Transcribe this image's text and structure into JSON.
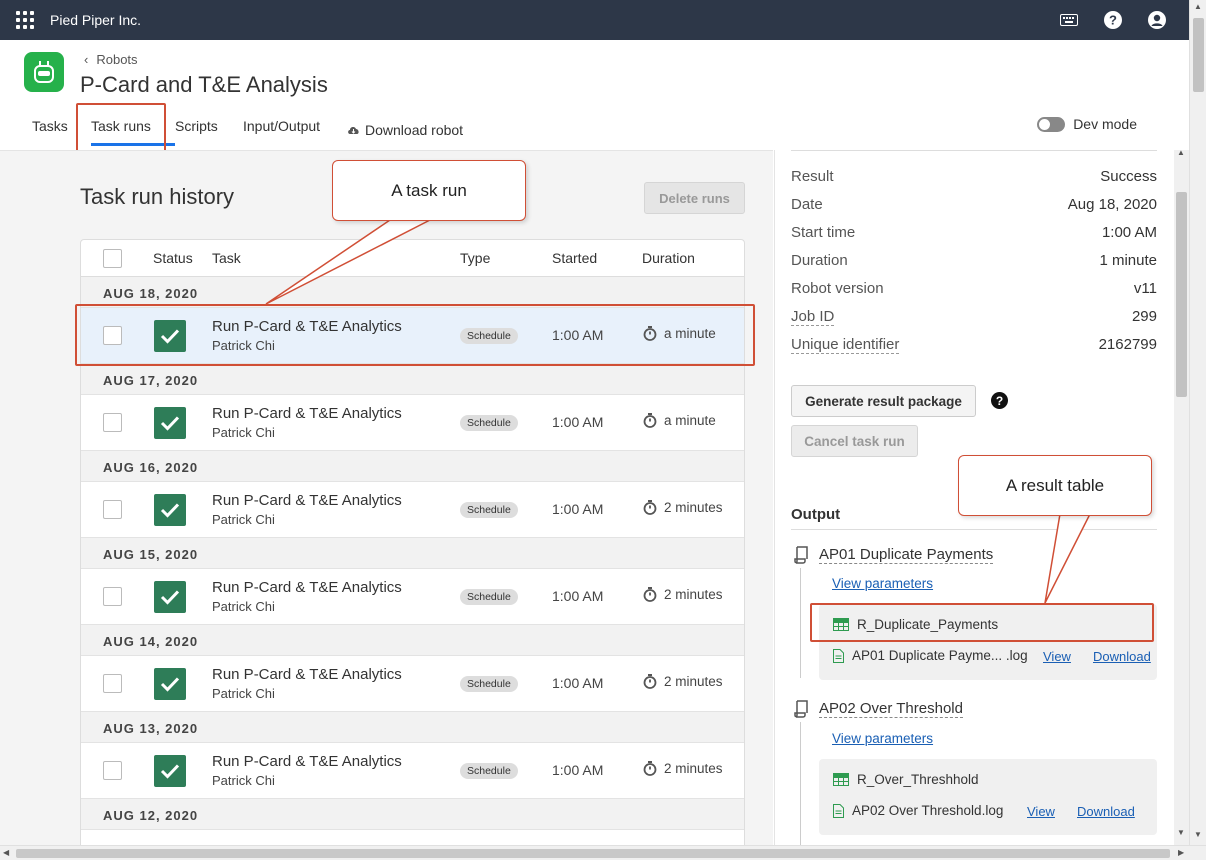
{
  "app": {
    "org_name": "Pied Piper Inc.",
    "breadcrumb": "Robots",
    "title": "P-Card and T&E Analysis",
    "tabs": [
      "Tasks",
      "Task runs",
      "Scripts",
      "Input/Output",
      "Download robot"
    ],
    "active_tab": "Task runs",
    "dev_mode_label": "Dev mode",
    "dev_mode_on": false
  },
  "history": {
    "title": "Task run history",
    "delete_label": "Delete runs",
    "columns": {
      "status": "Status",
      "task": "Task",
      "type": "Type",
      "started": "Started",
      "duration": "Duration"
    },
    "groups": [
      {
        "date": "AUG 18, 2020",
        "task": "Run P-Card & T&E Analytics",
        "user": "Patrick Chi",
        "type": "Schedule",
        "started": "1:00 AM",
        "duration": "a minute"
      },
      {
        "date": "AUG 17, 2020",
        "task": "Run P-Card & T&E Analytics",
        "user": "Patrick Chi",
        "type": "Schedule",
        "started": "1:00 AM",
        "duration": "a minute"
      },
      {
        "date": "AUG 16, 2020",
        "task": "Run P-Card & T&E Analytics",
        "user": "Patrick Chi",
        "type": "Schedule",
        "started": "1:00 AM",
        "duration": "2 minutes"
      },
      {
        "date": "AUG 15, 2020",
        "task": "Run P-Card & T&E Analytics",
        "user": "Patrick Chi",
        "type": "Schedule",
        "started": "1:00 AM",
        "duration": "2 minutes"
      },
      {
        "date": "AUG 14, 2020",
        "task": "Run P-Card & T&E Analytics",
        "user": "Patrick Chi",
        "type": "Schedule",
        "started": "1:00 AM",
        "duration": "2 minutes"
      },
      {
        "date": "AUG 13, 2020",
        "task": "Run P-Card & T&E Analytics",
        "user": "Patrick Chi",
        "type": "Schedule",
        "started": "1:00 AM",
        "duration": "2 minutes"
      }
    ],
    "last_date": "AUG 12, 2020"
  },
  "details": {
    "rows": [
      {
        "key": "Result",
        "value": "Success",
        "dotted": false
      },
      {
        "key": "Date",
        "value": "Aug 18, 2020",
        "dotted": false
      },
      {
        "key": "Start time",
        "value": "1:00 AM",
        "dotted": false
      },
      {
        "key": "Duration",
        "value": "1 minute",
        "dotted": false
      },
      {
        "key": "Robot version",
        "value": "v11",
        "dotted": false
      },
      {
        "key": "Job ID",
        "value": "299",
        "dotted": true
      },
      {
        "key": "Unique identifier",
        "value": "2162799",
        "dotted": true
      }
    ],
    "generate_label": "Generate result package",
    "help": "?",
    "cancel_label": "Cancel task run",
    "output_title": "Output",
    "scripts": [
      {
        "name": "AP01 Duplicate Payments",
        "params": "View parameters",
        "table": "R_Duplicate_Payments",
        "log": "AP01 Duplicate Payme... .log",
        "view": "View",
        "download": "Download"
      },
      {
        "name": "AP02 Over Threshold",
        "params": "View parameters",
        "table": "R_Over_Threshhold",
        "log": "AP02 Over Threshold.log",
        "view": "View",
        "download": "Download"
      }
    ]
  },
  "annotations": {
    "task_run": "A task run",
    "result_table": "A result table"
  },
  "colors": {
    "topbar": "#2d3748",
    "success": "#2e7d58",
    "accent": "#1a73e8",
    "callout": "#d04f36",
    "logo": "#26b14b"
  }
}
